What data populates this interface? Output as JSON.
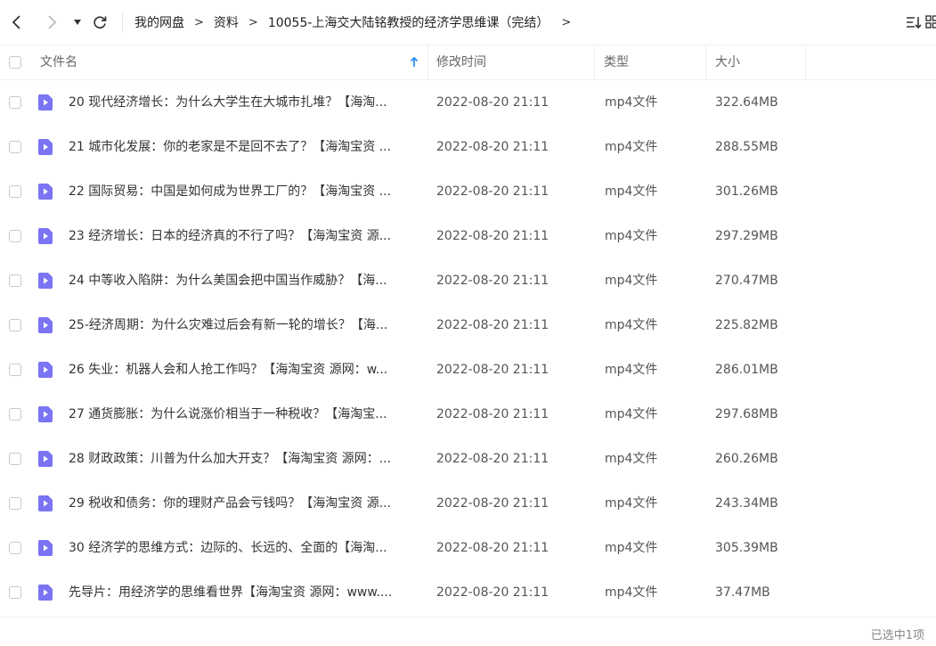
{
  "breadcrumb": [
    "我的网盘",
    "资料",
    "10055-上海交大陆铭教授的经济学思维课（完结）"
  ],
  "header": {
    "name": "文件名",
    "modified": "修改时间",
    "type": "类型",
    "size": "大小"
  },
  "icons": {
    "back": "chevron-left-icon",
    "forward": "chevron-right-icon",
    "history": "caret-down-icon",
    "refresh": "refresh-icon",
    "sort": "sort-icon",
    "view": "grid-view-icon",
    "file": "video-file-icon",
    "sort_indicator": "arrow-up-icon"
  },
  "colors": {
    "file_icon": "#7b74f4",
    "sort_arrow": "#2f8ef4"
  },
  "files": [
    {
      "name": "20 现代经济增长：为什么大学生在大城市扎堆？【海淘...",
      "modified": "2022-08-20 21:11",
      "type": "mp4文件",
      "size": "322.64MB"
    },
    {
      "name": "21 城市化发展：你的老家是不是回不去了？【海淘宝资 ...",
      "modified": "2022-08-20 21:11",
      "type": "mp4文件",
      "size": "288.55MB"
    },
    {
      "name": "22 国际贸易：中国是如何成为世界工厂的？【海淘宝资 ...",
      "modified": "2022-08-20 21:11",
      "type": "mp4文件",
      "size": "301.26MB"
    },
    {
      "name": "23 经济增长：日本的经济真的不行了吗？【海淘宝资 源...",
      "modified": "2022-08-20 21:11",
      "type": "mp4文件",
      "size": "297.29MB"
    },
    {
      "name": "24 中等收入陷阱：为什么美国会把中国当作威胁？【海...",
      "modified": "2022-08-20 21:11",
      "type": "mp4文件",
      "size": "270.47MB"
    },
    {
      "name": "25-经济周期：为什么灾难过后会有新一轮的增长？【海...",
      "modified": "2022-08-20 21:11",
      "type": "mp4文件",
      "size": "225.82MB"
    },
    {
      "name": "26 失业：机器人会和人抢工作吗？【海淘宝资 源网：w...",
      "modified": "2022-08-20 21:11",
      "type": "mp4文件",
      "size": "286.01MB"
    },
    {
      "name": "27 通货膨胀：为什么说涨价相当于一种税收？【海淘宝...",
      "modified": "2022-08-20 21:11",
      "type": "mp4文件",
      "size": "297.68MB"
    },
    {
      "name": "28 财政政策：川普为什么加大开支？【海淘宝资 源网：...",
      "modified": "2022-08-20 21:11",
      "type": "mp4文件",
      "size": "260.26MB"
    },
    {
      "name": "29 税收和债务：你的理财产品会亏钱吗？【海淘宝资 源...",
      "modified": "2022-08-20 21:11",
      "type": "mp4文件",
      "size": "243.34MB"
    },
    {
      "name": "30 经济学的思维方式：边际的、长远的、全面的【海淘...",
      "modified": "2022-08-20 21:11",
      "type": "mp4文件",
      "size": "305.39MB"
    },
    {
      "name": "先导片：用经济学的思维看世界【海淘宝资 源网：www....",
      "modified": "2022-08-20 21:11",
      "type": "mp4文件",
      "size": "37.47MB"
    }
  ],
  "footer": {
    "status": "已选中1项"
  }
}
